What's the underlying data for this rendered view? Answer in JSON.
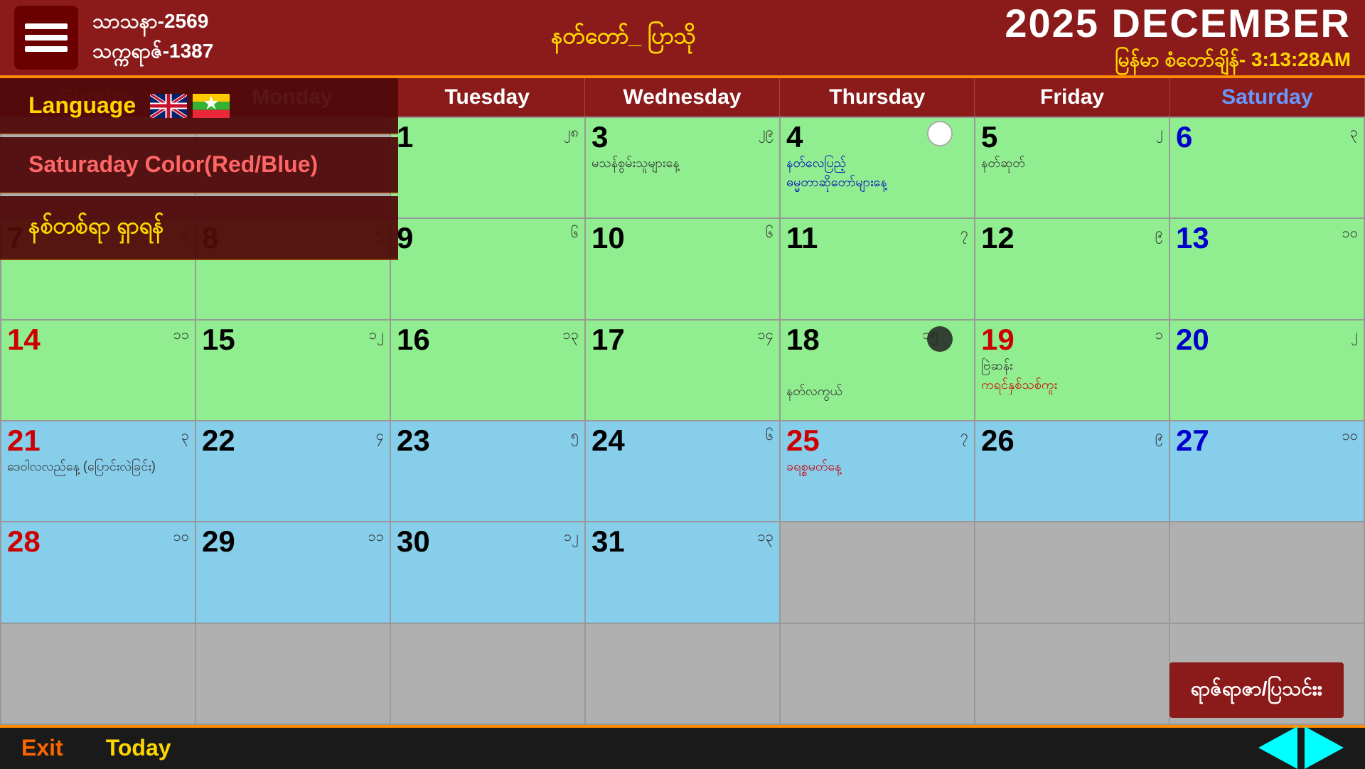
{
  "header": {
    "myanmar_year1": "သာသနာ-2569",
    "myanmar_year2": "သက္ကရာဇ်-1387",
    "moon_text": "နတ်တော်_ ပြာသို",
    "title": "2025 DECEMBER",
    "datetime_label": "မြန်မာ စံတော်ချိန်- 3:13:28AM"
  },
  "day_headers": [
    {
      "label": "Sunday",
      "type": "sunday"
    },
    {
      "label": "Monday",
      "type": "normal"
    },
    {
      "label": "Tuesday",
      "type": "normal"
    },
    {
      "label": "Wednesday",
      "type": "normal"
    },
    {
      "label": "Thursday",
      "type": "normal"
    },
    {
      "label": "Friday",
      "type": "normal"
    },
    {
      "label": "Saturday",
      "type": "saturday"
    }
  ],
  "overlay_menu": {
    "language_label": "Language",
    "saturday_color_label": "Saturaday Color(Red/Blue)",
    "festival_label": "နစ်တစ်ရာ ရှာရန်"
  },
  "footer": {
    "exit_label": "Exit",
    "today_label": "Today",
    "info_button_label": "ရာဇ်ရာဇာ/ပြသင်းး"
  },
  "calendar": {
    "rows": [
      [
        {
          "date": "",
          "mnum": "",
          "type": "gray",
          "text": ""
        },
        {
          "date": "",
          "mnum": "",
          "type": "gray",
          "text": ""
        },
        {
          "date": "1",
          "mnum": "၂၈",
          "type": "green",
          "date_color": "black",
          "text": ""
        },
        {
          "date": "3",
          "mnum": "၂၉",
          "type": "green",
          "date_color": "black",
          "text": "မသန်စွမ်းသူများနေ့"
        },
        {
          "date": "4",
          "mnum": "၁",
          "type": "green",
          "date_color": "black",
          "text": "နတ်လေပြည့်\nဓမ္မတာဆိုတော်များနေ့",
          "today_circle": true
        },
        {
          "date": "5",
          "mnum": "၂",
          "type": "green",
          "date_color": "black",
          "text": "နတ်ဆုတ်"
        },
        {
          "date": "6",
          "mnum": "၃",
          "type": "green",
          "date_color": "blue",
          "text": ""
        }
      ],
      [
        {
          "date": "7",
          "mnum": "၄",
          "type": "green",
          "date_color": "black",
          "text": ""
        },
        {
          "date": "8",
          "mnum": "၅",
          "type": "green",
          "date_color": "black",
          "text": ""
        },
        {
          "date": "9",
          "mnum": "၆",
          "type": "green",
          "date_color": "black",
          "text": ""
        },
        {
          "date": "10",
          "mnum": "၆",
          "type": "green",
          "date_color": "black",
          "text": ""
        },
        {
          "date": "11",
          "mnum": "၇",
          "type": "green",
          "date_color": "black",
          "text": ""
        },
        {
          "date": "12",
          "mnum": "၉",
          "type": "green",
          "date_color": "black",
          "text": ""
        },
        {
          "date": "13",
          "mnum": "၁၀",
          "type": "green",
          "date_color": "blue",
          "text": ""
        }
      ],
      [
        {
          "date": "14",
          "mnum": "၁၁",
          "type": "green",
          "date_color": "red",
          "text": ""
        },
        {
          "date": "15",
          "mnum": "၁၂",
          "type": "green",
          "date_color": "black",
          "text": ""
        },
        {
          "date": "16",
          "mnum": "၁၃",
          "type": "green",
          "date_color": "black",
          "text": ""
        },
        {
          "date": "17",
          "mnum": "၁၄",
          "type": "green",
          "date_color": "black",
          "text": ""
        },
        {
          "date": "18",
          "mnum": "၁၅",
          "type": "green",
          "date_color": "black",
          "text": "နတ်လကွယ်",
          "today_dot": true
        },
        {
          "date": "19",
          "mnum": "၁",
          "type": "green",
          "date_color": "red",
          "text": "ဗြဲဆန်း\nကရင်နှစ်သစ်ကူး"
        },
        {
          "date": "20",
          "mnum": "၂",
          "type": "green",
          "date_color": "blue",
          "text": ""
        }
      ],
      [
        {
          "date": "21",
          "mnum": "၃",
          "type": "lightblue",
          "date_color": "red",
          "text": "ဒေဝါလလည်နေ့ (ပြောင်းလဲခြင်း)"
        },
        {
          "date": "22",
          "mnum": "၄",
          "type": "lightblue",
          "date_color": "black",
          "text": ""
        },
        {
          "date": "23",
          "mnum": "၅",
          "type": "lightblue",
          "date_color": "black",
          "text": ""
        },
        {
          "date": "24",
          "mnum": "၆",
          "type": "lightblue",
          "date_color": "black",
          "text": ""
        },
        {
          "date": "25",
          "mnum": "၇",
          "type": "lightblue",
          "date_color": "red",
          "text": "ခရစ္စမတ်နေ့"
        },
        {
          "date": "26",
          "mnum": "၉",
          "type": "lightblue",
          "date_color": "black",
          "text": ""
        },
        {
          "date": "27",
          "mnum": "၁၀",
          "type": "lightblue",
          "date_color": "blue",
          "text": ""
        }
      ],
      [
        {
          "date": "28",
          "mnum": "၁၀",
          "type": "lightblue",
          "date_color": "red",
          "text": ""
        },
        {
          "date": "29",
          "mnum": "၁၁",
          "type": "lightblue",
          "date_color": "black",
          "text": ""
        },
        {
          "date": "30",
          "mnum": "၁၂",
          "type": "lightblue",
          "date_color": "black",
          "text": ""
        },
        {
          "date": "31",
          "mnum": "၁၃",
          "type": "lightblue",
          "date_color": "black",
          "text": ""
        },
        {
          "date": "",
          "mnum": "",
          "type": "gray",
          "text": ""
        },
        {
          "date": "",
          "mnum": "",
          "type": "gray",
          "text": ""
        },
        {
          "date": "",
          "mnum": "",
          "type": "gray",
          "text": ""
        }
      ],
      [
        {
          "date": "",
          "mnum": "",
          "type": "gray",
          "text": ""
        },
        {
          "date": "",
          "mnum": "",
          "type": "gray",
          "text": ""
        },
        {
          "date": "",
          "mnum": "",
          "type": "empty",
          "text": ""
        },
        {
          "date": "",
          "mnum": "",
          "type": "empty",
          "text": ""
        },
        {
          "date": "",
          "mnum": "",
          "type": "empty",
          "text": ""
        },
        {
          "date": "",
          "mnum": "",
          "type": "empty",
          "text": ""
        },
        {
          "date": "",
          "mnum": "",
          "type": "empty",
          "text": ""
        }
      ]
    ]
  }
}
